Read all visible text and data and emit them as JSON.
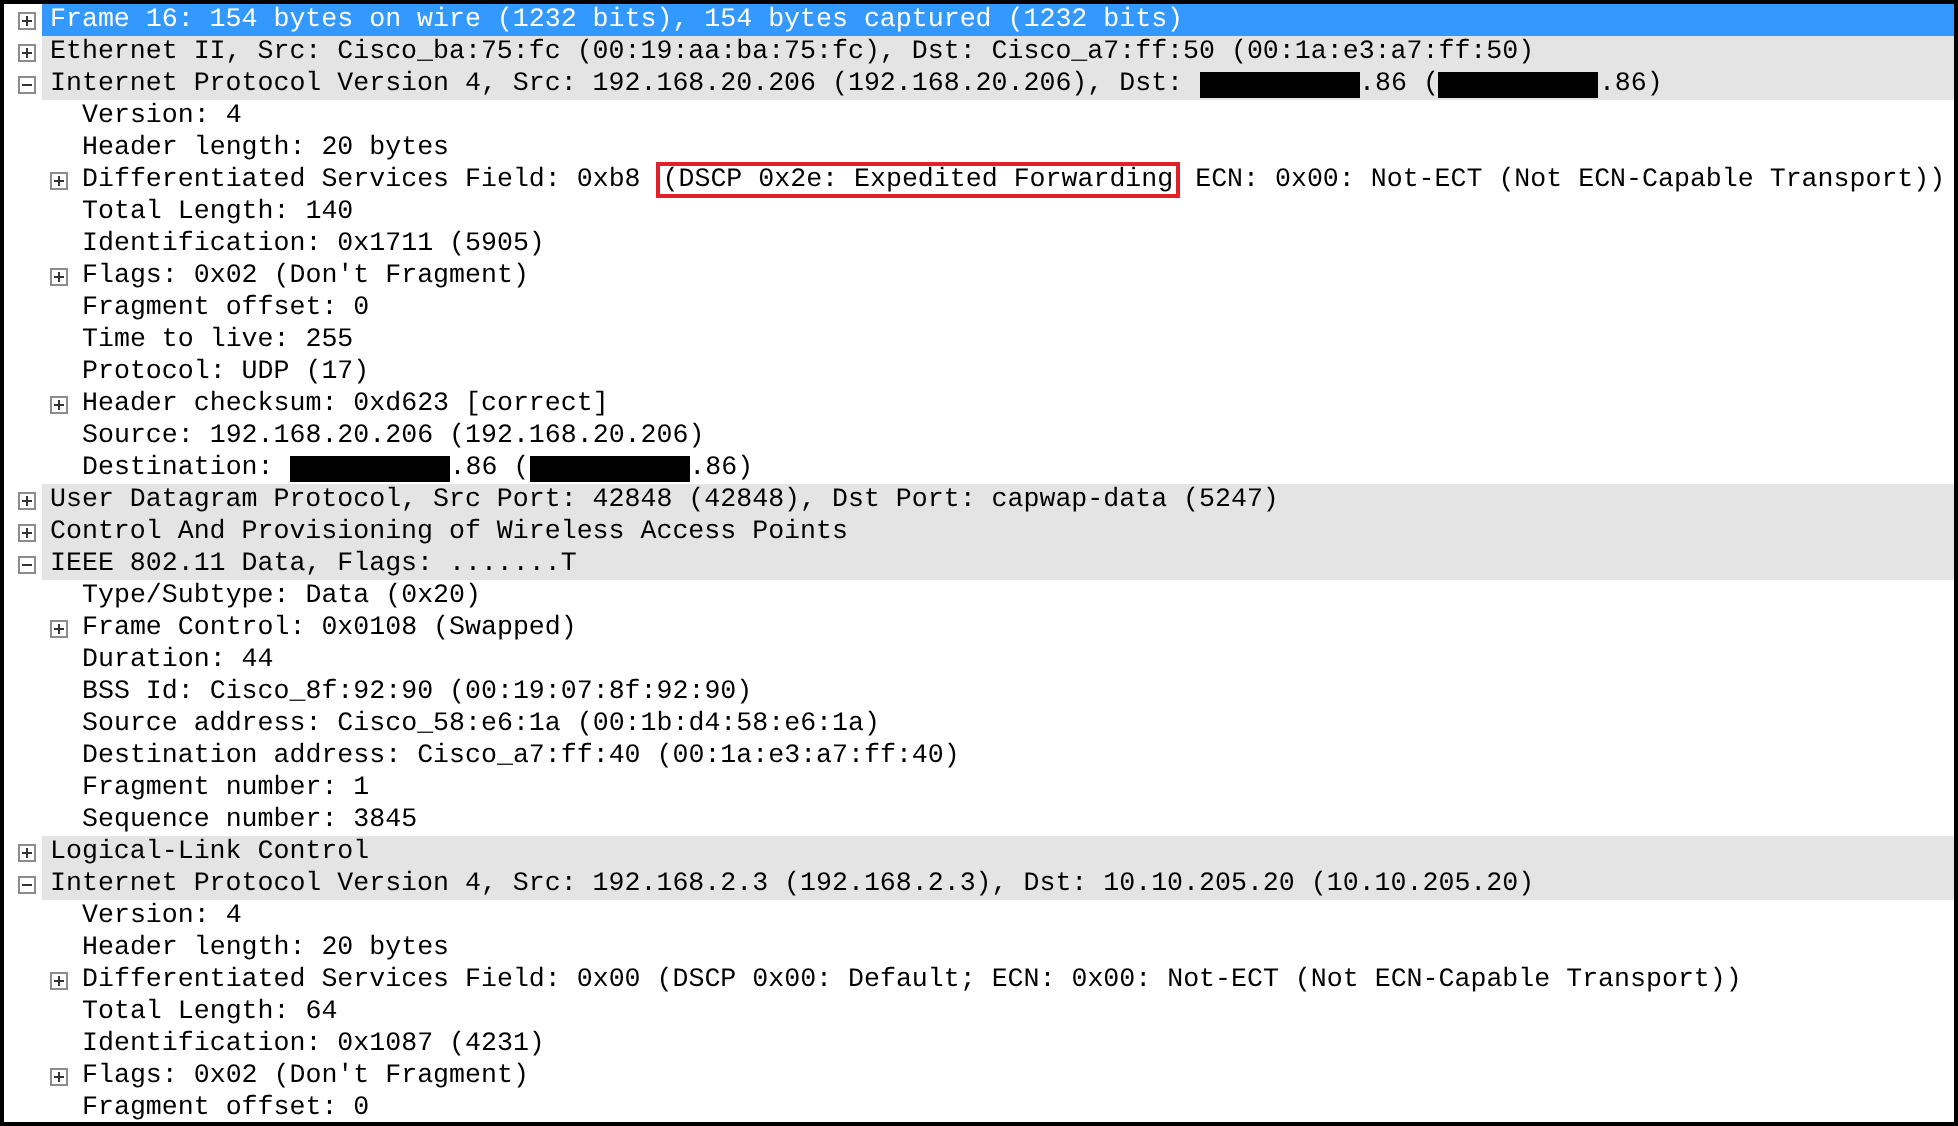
{
  "packet_details": [
    {
      "text": "Frame 16: 154 bytes on wire (1232 bits), 154 bytes captured (1232 bits)",
      "expanded": false,
      "selected": true
    },
    {
      "text": "Ethernet II, Src: Cisco_ba:75:fc (00:19:aa:ba:75:fc), Dst: Cisco_a7:ff:50 (00:1a:e3:a7:ff:50)",
      "expanded": false,
      "selected": false
    },
    {
      "parts": [
        {
          "kind": "text",
          "text": "Internet Protocol Version 4, Src: 192.168.20.206 (192.168.20.206), Dst: "
        },
        {
          "kind": "redacted"
        },
        {
          "kind": "text",
          "text": ".86 ("
        },
        {
          "kind": "redacted"
        },
        {
          "kind": "text",
          "text": ".86)"
        }
      ],
      "expanded": true,
      "selected": false,
      "children": [
        {
          "text": "Version: 4"
        },
        {
          "text": "Header length: 20 bytes"
        },
        {
          "parts": [
            {
              "kind": "text",
              "text": "Differentiated Services Field: 0xb8 "
            },
            {
              "kind": "highlight",
              "text": "(DSCP 0x2e: Expedited Forwarding"
            },
            {
              "kind": "text",
              "text": " ECN: 0x00: Not-ECT (Not ECN-Capable Transport))"
            }
          ],
          "expanded": false
        },
        {
          "text": "Total Length: 140"
        },
        {
          "text": "Identification: 0x1711 (5905)"
        },
        {
          "text": "Flags: 0x02 (Don't Fragment)",
          "expanded": false
        },
        {
          "text": "Fragment offset: 0"
        },
        {
          "text": "Time to live: 255"
        },
        {
          "text": "Protocol: UDP (17)"
        },
        {
          "text": "Header checksum: 0xd623 [correct]",
          "expanded": false
        },
        {
          "text": "Source: 192.168.20.206 (192.168.20.206)"
        },
        {
          "parts": [
            {
              "kind": "text",
              "text": "Destination: "
            },
            {
              "kind": "redacted"
            },
            {
              "kind": "text",
              "text": ".86 ("
            },
            {
              "kind": "redacted"
            },
            {
              "kind": "text",
              "text": ".86)"
            }
          ]
        }
      ]
    },
    {
      "text": "User Datagram Protocol, Src Port: 42848 (42848), Dst Port: capwap-data (5247)",
      "expanded": false,
      "selected": false
    },
    {
      "text": "Control And Provisioning of Wireless Access Points",
      "expanded": false,
      "selected": false
    },
    {
      "text": "IEEE 802.11 Data, Flags: .......T",
      "expanded": true,
      "selected": false,
      "children": [
        {
          "text": "Type/Subtype: Data (0x20)"
        },
        {
          "text": "Frame Control: 0x0108 (Swapped)",
          "expanded": false
        },
        {
          "text": "Duration: 44"
        },
        {
          "text": "BSS Id: Cisco_8f:92:90 (00:19:07:8f:92:90)"
        },
        {
          "text": "Source address: Cisco_58:e6:1a (00:1b:d4:58:e6:1a)"
        },
        {
          "text": "Destination address: Cisco_a7:ff:40 (00:1a:e3:a7:ff:40)"
        },
        {
          "text": "Fragment number: 1"
        },
        {
          "text": "Sequence number: 3845"
        }
      ]
    },
    {
      "text": "Logical-Link Control",
      "expanded": false,
      "selected": false
    },
    {
      "text": "Internet Protocol Version 4, Src: 192.168.2.3 (192.168.2.3), Dst: 10.10.205.20 (10.10.205.20)",
      "expanded": true,
      "selected": false,
      "children": [
        {
          "text": "Version: 4"
        },
        {
          "text": "Header length: 20 bytes"
        },
        {
          "text": "Differentiated Services Field: 0x00 (DSCP 0x00: Default; ECN: 0x00: Not-ECT (Not ECN-Capable Transport))",
          "expanded": false
        },
        {
          "text": "Total Length: 64"
        },
        {
          "text": "Identification: 0x1087 (4231)"
        },
        {
          "text": "Flags: 0x02 (Don't Fragment)",
          "expanded": false
        },
        {
          "text": "Fragment offset: 0"
        }
      ]
    }
  ]
}
